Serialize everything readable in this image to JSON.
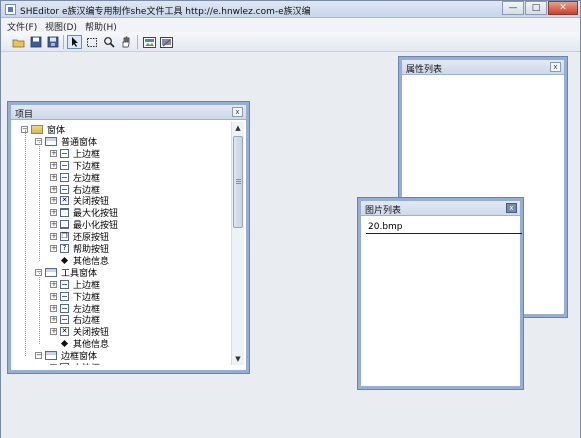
{
  "window": {
    "title": "SHEditor  e族汉编专用制作she文件工具  http://e.hnwlez.com-e族汉编",
    "buttons": {
      "minimize": "—",
      "maximize": "□",
      "close": "✕"
    }
  },
  "menu": [
    "文件(F)",
    "视图(D)",
    "帮助(H)"
  ],
  "toolbar": [
    "open-folder-icon",
    "save-icon",
    "save-all-icon",
    "pointer-icon",
    "marquee-select-icon",
    "zoom-icon",
    "hand-pan-icon",
    "image-icon",
    "image-edit-icon"
  ],
  "panels": {
    "project": {
      "title": "项目",
      "close": "x"
    },
    "properties": {
      "title": "属性列表",
      "close": "x"
    },
    "images": {
      "title": "图片列表",
      "close": "x"
    }
  },
  "tree": [
    {
      "label": "窗体",
      "level": 0,
      "icon": "folder"
    },
    {
      "label": "普通窗体",
      "level": 1,
      "icon": "form"
    },
    {
      "label": "上边框",
      "level": 2,
      "icon": "bar"
    },
    {
      "label": "下边框",
      "level": 2,
      "icon": "bar"
    },
    {
      "label": "左边框",
      "level": 2,
      "icon": "bar"
    },
    {
      "label": "右边框",
      "level": 2,
      "icon": "bar"
    },
    {
      "label": "关闭按钮",
      "level": 2,
      "icon": "x"
    },
    {
      "label": "最大化按钮",
      "level": 2,
      "icon": "max"
    },
    {
      "label": "最小化按钮",
      "level": 2,
      "icon": "min"
    },
    {
      "label": "还原按钮",
      "level": 2,
      "icon": "restore"
    },
    {
      "label": "帮助按钮",
      "level": 2,
      "icon": "help"
    },
    {
      "label": "其他信息",
      "level": 2,
      "icon": "diamond"
    },
    {
      "label": "工具窗体",
      "level": 1,
      "icon": "form"
    },
    {
      "label": "上边框",
      "level": 2,
      "icon": "bar"
    },
    {
      "label": "下边框",
      "level": 2,
      "icon": "bar"
    },
    {
      "label": "左边框",
      "level": 2,
      "icon": "bar"
    },
    {
      "label": "右边框",
      "level": 2,
      "icon": "bar"
    },
    {
      "label": "关闭按钮",
      "level": 2,
      "icon": "x"
    },
    {
      "label": "其他信息",
      "level": 2,
      "icon": "diamond"
    },
    {
      "label": "边框窗体",
      "level": 1,
      "icon": "form"
    },
    {
      "label": "上边框",
      "level": 2,
      "icon": "bar"
    }
  ],
  "image_list": [
    "20.bmp"
  ]
}
